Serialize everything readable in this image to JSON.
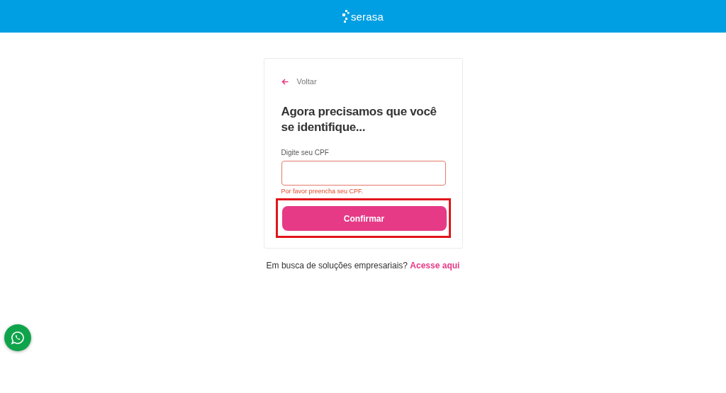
{
  "header": {
    "logo": "serasa"
  },
  "card": {
    "back": "Voltar",
    "title": "Agora precisamos que você se identifique...",
    "cpf_field": {
      "label": "Digite seu CPF",
      "error": "Por favor preencha seu CPF."
    },
    "confirm_button": {
      "label": "Confirmar",
      "highlighted": true
    }
  },
  "footer": {
    "text": "Em busca de soluções empresariais?",
    "link": "Acesse aqui"
  }
}
